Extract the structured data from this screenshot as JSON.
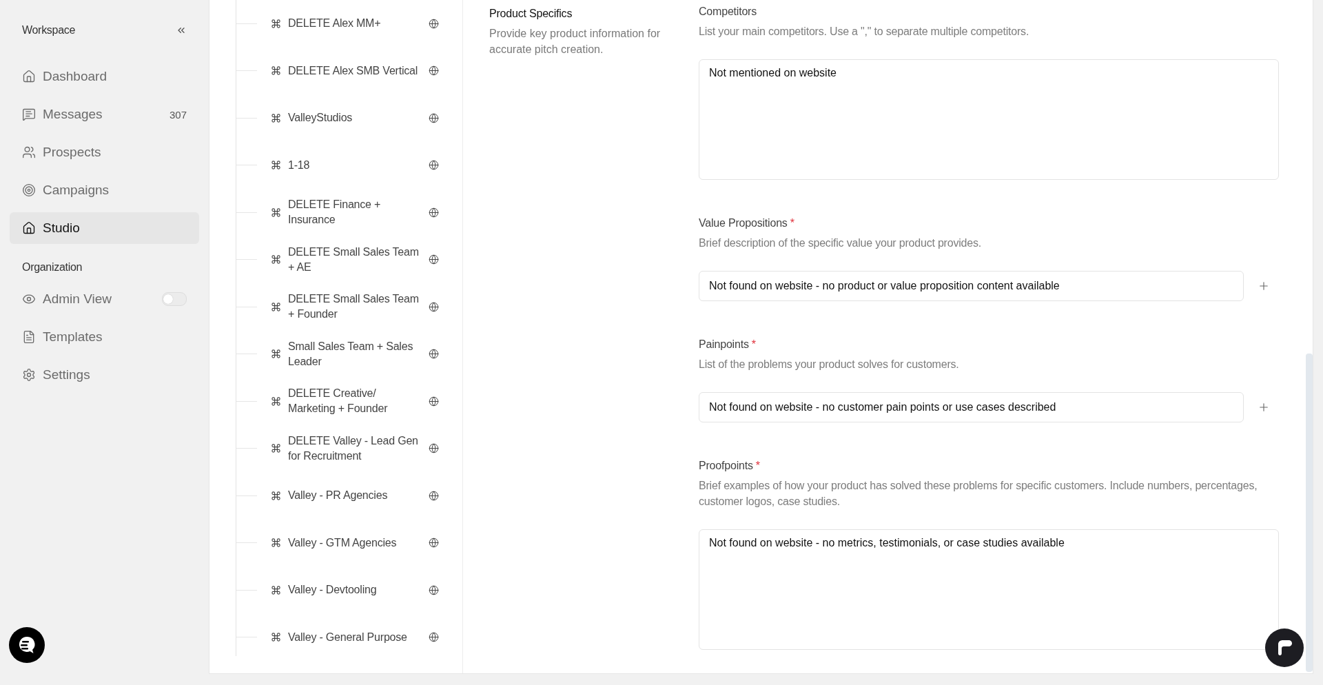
{
  "sidebar": {
    "workspace_label": "Workspace",
    "items": [
      {
        "label": "Dashboard",
        "selected": false
      },
      {
        "label": "Messages",
        "count": "307",
        "selected": false
      },
      {
        "label": "Prospects",
        "selected": false
      },
      {
        "label": "Campaigns",
        "selected": false
      },
      {
        "label": "Studio",
        "selected": true
      }
    ],
    "organization_label": "Organization",
    "org_items": [
      {
        "label": "Admin View",
        "kind": "toggle",
        "on": false
      },
      {
        "label": "Templates",
        "kind": "link"
      },
      {
        "label": "Settings",
        "kind": "link"
      }
    ]
  },
  "pitch_list": [
    {
      "label": "DELETE Alex MM+"
    },
    {
      "label": "DELETE Alex SMB Vertical"
    },
    {
      "label": "ValleyStudios"
    },
    {
      "label": "1-18"
    },
    {
      "label": "DELETE Finance + Insurance"
    },
    {
      "label": "DELETE Small Sales Team + AE"
    },
    {
      "label": "DELETE Small Sales Team + Founder"
    },
    {
      "label": "Small Sales Team + Sales Leader"
    },
    {
      "label": "DELETE Creative/ Marketing + Founder"
    },
    {
      "label": "DELETE Valley - Lead Gen for Recruitment"
    },
    {
      "label": "Valley - PR Agencies"
    },
    {
      "label": "Valley - GTM Agencies"
    },
    {
      "label": "Valley - Devtooling"
    },
    {
      "label": "Valley - General Purpose"
    }
  ],
  "form": {
    "section_title": "Product Specifics",
    "section_description": "Provide key product information for accurate pitch creation.",
    "fields": [
      {
        "label": "Competitors",
        "hint": "List your main competitors. Use a \",\" to separate multiple competitors.",
        "kind": "textarea",
        "value": "Not mentioned on website"
      },
      {
        "label": "Value Propositions",
        "required_mark": "*",
        "hint": "Brief description of the specific value your product provides.",
        "kind": "input",
        "value": "Not found on website - no product or value proposition content available"
      },
      {
        "label": "Painpoints",
        "required_mark": "*",
        "hint": "List of the problems your product solves for customers.",
        "kind": "input",
        "value": "Not found on website - no customer pain points or use cases described"
      },
      {
        "label": "Proofpoints",
        "required_mark": "*",
        "hint": "Brief examples of how your product has solved these problems for specific customers. Include numbers, percentages, customer logos, case studies.",
        "kind": "textarea",
        "value": "Not found on website - no metrics, testimonials, or case studies available"
      }
    ]
  }
}
